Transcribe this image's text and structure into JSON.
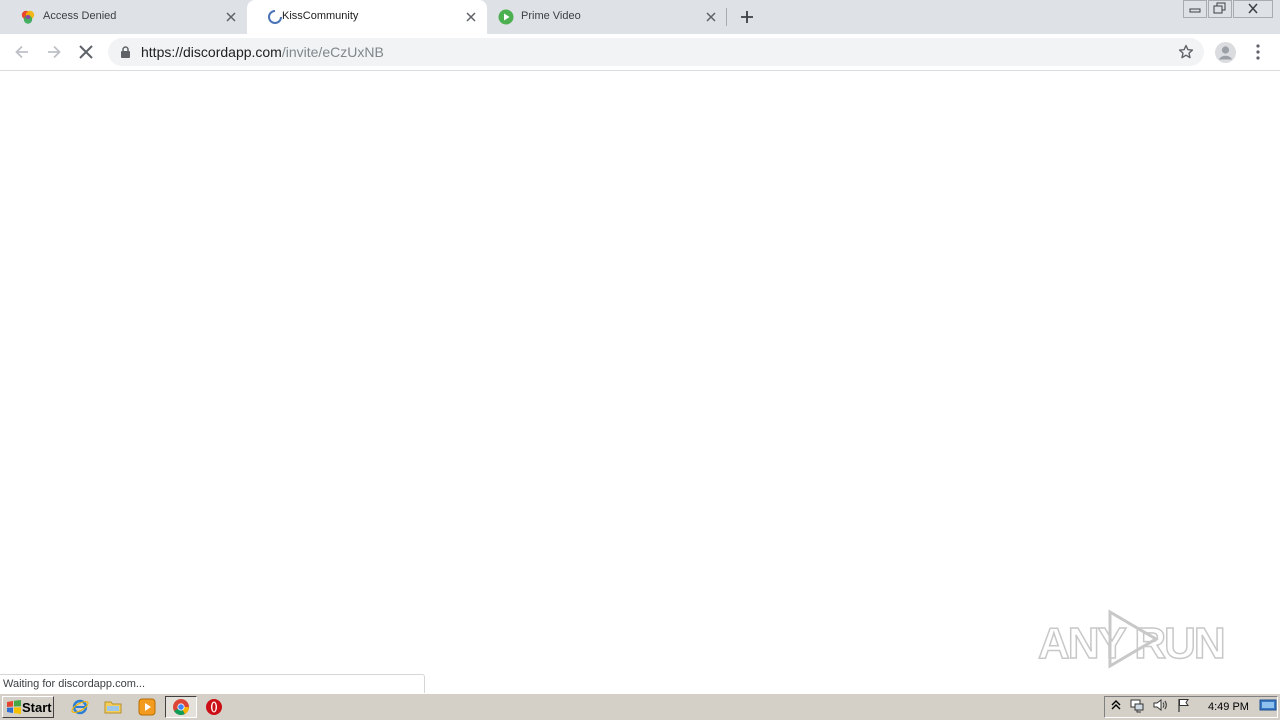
{
  "browser": {
    "tabs": [
      {
        "title": "Access Denied",
        "favicon": "kissanime-icon",
        "active": false
      },
      {
        "title": "KissCommunity",
        "favicon": "loading-spinner-icon",
        "active": true
      },
      {
        "title": "Prime Video",
        "favicon": "play-icon",
        "active": false
      }
    ],
    "new_tab_icon": "plus-icon",
    "window_controls": [
      "minimize-icon",
      "restore-icon",
      "close-icon"
    ],
    "toolbar": {
      "back_icon": "arrow-left-icon",
      "forward_icon": "arrow-right-icon",
      "stop_icon": "close-icon",
      "url_host": "https://discordapp.com",
      "url_path": "/invite/eCzUxNB",
      "bookmark_icon": "star-icon",
      "profile_icon": "avatar-icon",
      "menu_icon": "kebab-menu-icon"
    },
    "status_text": "Waiting for discordapp.com...",
    "accent_color": "#dee1e6"
  },
  "watermark": {
    "text": "ANY RUN"
  },
  "taskbar": {
    "start_label": "Start",
    "pinned": [
      "internet-explorer-icon",
      "folder-icon",
      "media-player-icon",
      "chrome-icon",
      "opera-icon"
    ],
    "tray": [
      "up-arrow-icon",
      "network-icon",
      "speaker-icon",
      "flag-icon",
      "show-desktop-icon"
    ],
    "clock": "4:49 PM"
  }
}
